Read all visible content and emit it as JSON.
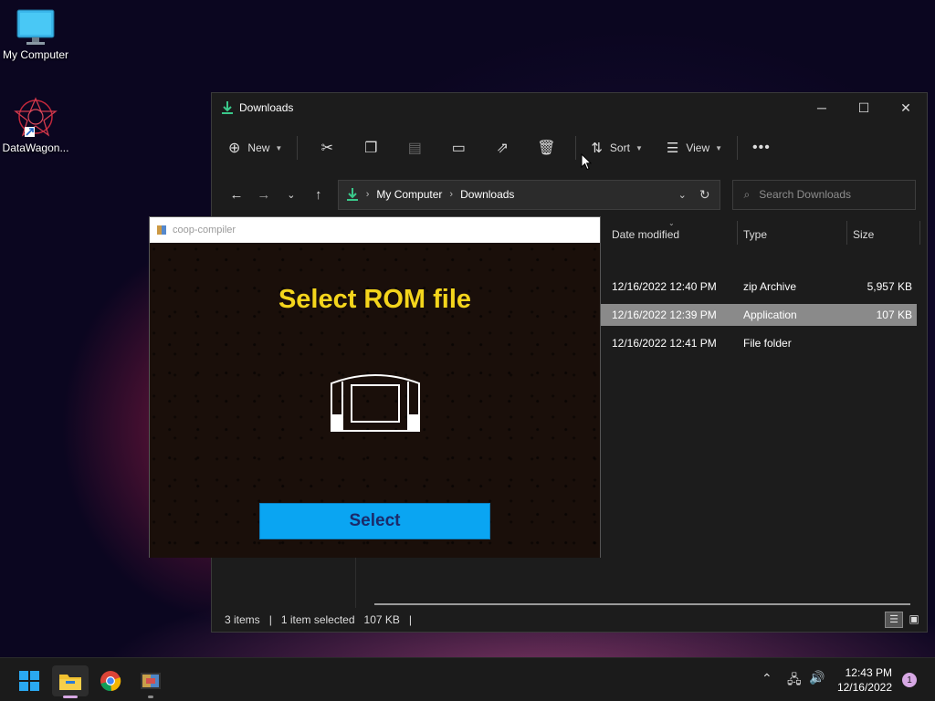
{
  "desktop": {
    "icons": [
      {
        "label": "My Computer"
      },
      {
        "label": "DataWagon..."
      }
    ]
  },
  "explorer": {
    "title": "Downloads",
    "toolbar": {
      "new_label": "New",
      "sort_label": "Sort",
      "view_label": "View"
    },
    "address": {
      "crumbs": [
        "My Computer",
        "Downloads"
      ]
    },
    "search_placeholder": "Search Downloads",
    "columns": [
      "Date modified",
      "Type",
      "Size"
    ],
    "rows": [
      {
        "date": "12/16/2022 12:40 PM",
        "type": "zip Archive",
        "size": "5,957 KB",
        "selected": false
      },
      {
        "date": "12/16/2022 12:39 PM",
        "type": "Application",
        "size": "107 KB",
        "selected": true
      },
      {
        "date": "12/16/2022 12:41 PM",
        "type": "File folder",
        "size": "",
        "selected": false
      }
    ],
    "status": {
      "items": "3 items",
      "selected": "1 item selected",
      "size": "107 KB"
    }
  },
  "dialog": {
    "title": "coop-compiler",
    "heading": "Select ROM file",
    "button_label": "Select"
  },
  "taskbar": {
    "time": "12:43 PM",
    "date": "12/16/2022",
    "notification_count": "1"
  },
  "colors": {
    "accent_green": "#3ac88a",
    "dialog_heading": "#f4d51c",
    "select_button": "#0aa5f2"
  }
}
